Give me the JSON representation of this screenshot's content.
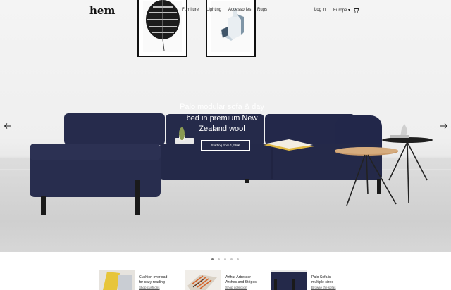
{
  "header": {
    "logo": "hem",
    "nav": [
      "Furniture",
      "Lighting",
      "Accessories",
      "Rugs"
    ],
    "login": "Log in",
    "region": "Europe ▾",
    "cart_icon": "cart-icon"
  },
  "hero": {
    "title_lines": [
      "Palo modular sofa & day",
      "bed in premium New",
      "Zealand wool"
    ],
    "cta": "Starting from 1,299€",
    "prev_icon": "arrow-left-icon",
    "next_icon": "arrow-right-icon"
  },
  "carousel": {
    "slides": 5,
    "active": 0
  },
  "products": [
    {
      "title_lines": [
        "Cushion overload",
        "for cozy reading"
      ],
      "link": "Shop cushions"
    },
    {
      "title_lines": [
        "Arthur Arbesser",
        "Arches and Stripes"
      ],
      "link": "Shop collection"
    },
    {
      "title_lines": [
        "Palo Sofa in",
        "multiple sizes"
      ],
      "link": "Browse the sofas"
    }
  ],
  "colors": {
    "sofa": "#23284a",
    "accent_white": "#ffffff"
  }
}
